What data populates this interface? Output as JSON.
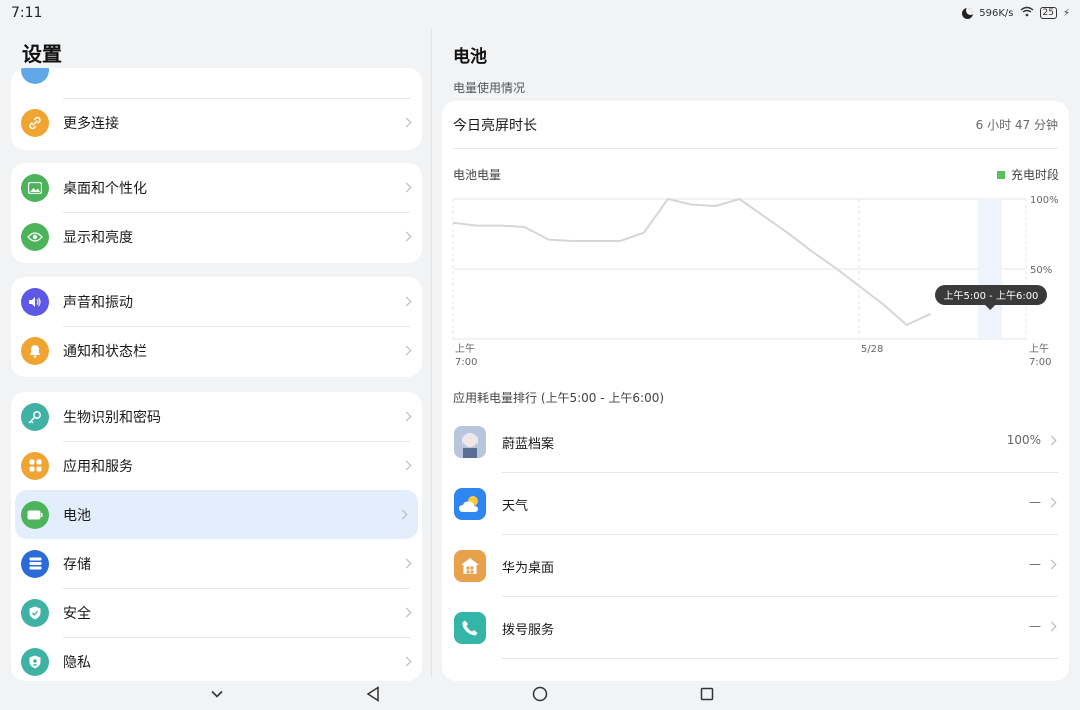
{
  "status_bar": {
    "time": "7:11",
    "net_speed": "596K/s",
    "battery": "25"
  },
  "left": {
    "title": "设置",
    "items": [
      {
        "label": "更多连接",
        "icon": "link-icon",
        "color": "#f0a431"
      },
      {
        "label": "桌面和个性化",
        "icon": "image-icon",
        "color": "#4cb35a"
      },
      {
        "label": "显示和亮度",
        "icon": "eye-icon",
        "color": "#4cb35a"
      },
      {
        "label": "声音和振动",
        "icon": "speaker-icon",
        "color": "#5d59e6"
      },
      {
        "label": "通知和状态栏",
        "icon": "bell-icon",
        "color": "#f0a431"
      },
      {
        "label": "生物识别和密码",
        "icon": "key-icon",
        "color": "#3fb2a5"
      },
      {
        "label": "应用和服务",
        "icon": "apps-icon",
        "color": "#f0a431"
      },
      {
        "label": "电池",
        "icon": "battery-icon",
        "color": "#4cb35a"
      },
      {
        "label": "存储",
        "icon": "storage-icon",
        "color": "#2b6bd8"
      },
      {
        "label": "安全",
        "icon": "shield-icon",
        "color": "#3fb2a5"
      },
      {
        "label": "隐私",
        "icon": "privacy-icon",
        "color": "#3fb2a5"
      }
    ]
  },
  "right": {
    "title": "电池",
    "section_label": "电量使用情况",
    "screen_on_label": "今日亮屏时长",
    "screen_on_value": "6 小时 47 分钟",
    "chart_title": "电池电量",
    "legend_label": "充电时段",
    "rank_title": "应用耗电量排行 (上午5:00 - 上午6:00)",
    "apps": [
      {
        "name": "蔚蓝档案",
        "value": "100%",
        "icon": "game-avatar-icon",
        "color": "#8fa6c8"
      },
      {
        "name": "天气",
        "value": "—",
        "icon": "weather-icon",
        "color": "#2f86f0"
      },
      {
        "name": "华为桌面",
        "value": "—",
        "icon": "home-icon",
        "color": "#e8a04a"
      },
      {
        "name": "拨号服务",
        "value": "—",
        "icon": "phone-icon",
        "color": "#35b5a8"
      }
    ]
  },
  "chart_data": {
    "type": "line",
    "x": [
      0,
      1,
      2,
      3,
      4,
      5,
      6,
      7,
      8,
      9,
      10,
      11,
      12,
      13,
      14,
      15,
      16,
      17,
      18,
      19,
      20,
      21,
      22,
      23,
      24
    ],
    "tick_labels": [
      {
        "line1": "上午",
        "line2": "7:00"
      },
      {
        "line1": "5/28",
        "line2": ""
      },
      {
        "line1": "上午",
        "line2": "7:00"
      }
    ],
    "series": [
      {
        "values": [
          83,
          81,
          81,
          80,
          71,
          70,
          70,
          70,
          76,
          100,
          96,
          95,
          100,
          88,
          76,
          63,
          51,
          38,
          25,
          10,
          18
        ]
      }
    ],
    "ylabels": [
      "100%",
      "50%"
    ],
    "ylim": [
      0,
      100
    ],
    "tooltip": "上午5:00 - 上午6:00",
    "colors": {
      "line": "#d6d6d6",
      "highlight": "#2255d6",
      "grid": "#e4e4e4"
    }
  },
  "nav": {
    "back": "back-icon",
    "home": "home-circle-icon",
    "recents": "recents-icon",
    "collapse": "chevron-down-icon"
  }
}
